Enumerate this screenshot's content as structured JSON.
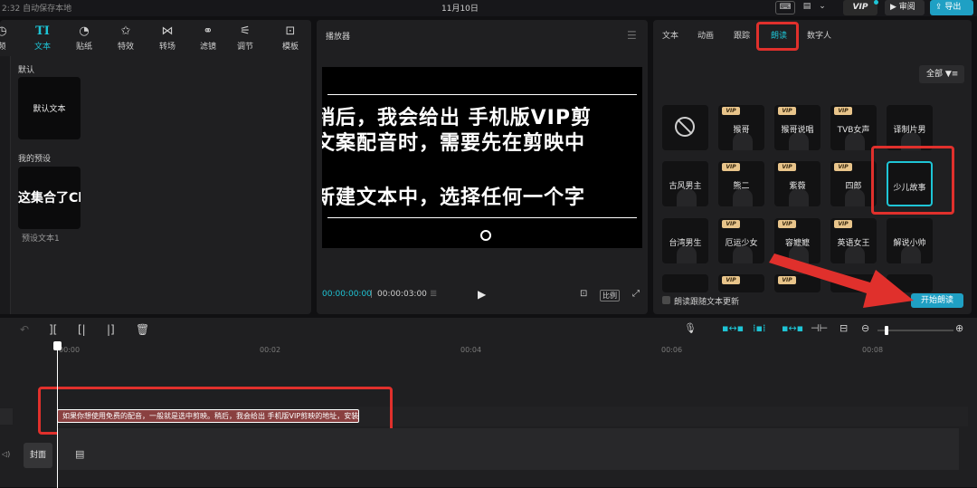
{
  "topbar": {
    "status": "2:32 自动保存本地",
    "date": "11月10日",
    "vip_label": "VIP",
    "review_label": "审阅",
    "export_label": "导出"
  },
  "left_panel": {
    "tabs": [
      {
        "icon": "◷",
        "label": "频",
        "icon_name": "media-icon"
      },
      {
        "icon": "TI",
        "label": "文本",
        "icon_name": "text-icon",
        "active": true
      },
      {
        "icon": "◔",
        "label": "贴纸",
        "icon_name": "sticker-icon"
      },
      {
        "icon": "✩",
        "label": "特效",
        "icon_name": "effects-icon"
      },
      {
        "icon": "⋈",
        "label": "转场",
        "icon_name": "transition-icon"
      },
      {
        "icon": "⚭",
        "label": "滤镜",
        "icon_name": "filter-icon"
      },
      {
        "icon": "⚟",
        "label": "调节",
        "icon_name": "adjust-icon"
      },
      {
        "icon": "⊡",
        "label": "模板",
        "icon_name": "template-icon"
      }
    ],
    "default_section": "默认",
    "default_text_card": "默认文本",
    "presets_section": "我的预设",
    "preset_card_text": "这集合了Ch",
    "preset_name": "预设文本1"
  },
  "player": {
    "title": "播放器",
    "lines": [
      "稍后，我会给出 手机版VIP剪",
      "文案配音时，需要先在剪映中",
      "新建文本中，选择任何一个字"
    ],
    "current_time": "00:00:00:00",
    "separator": "|",
    "total_time": "00:00:03:00",
    "ratio_label": "比例"
  },
  "right_panel": {
    "tabs": [
      "文本",
      "动画",
      "跟踪",
      "朗读",
      "数字人"
    ],
    "active_tab": "朗读",
    "filter_label": "全部",
    "voices": [
      {
        "name": "",
        "vip": false,
        "none": true
      },
      {
        "name": "猴哥",
        "vip": true
      },
      {
        "name": "猴哥说唱",
        "vip": true
      },
      {
        "name": "TVB女声",
        "vip": true
      },
      {
        "name": "译制片男",
        "vip": false
      },
      {
        "name": "古风男主",
        "vip": false
      },
      {
        "name": "熊二",
        "vip": true
      },
      {
        "name": "紫薇",
        "vip": true
      },
      {
        "name": "四郎",
        "vip": true
      },
      {
        "name": "少儿故事",
        "vip": false,
        "selected": true
      },
      {
        "name": "台湾男生",
        "vip": false
      },
      {
        "name": "厄运少女",
        "vip": true
      },
      {
        "name": "容嬷嬷",
        "vip": true
      },
      {
        "name": "英语女王",
        "vip": true
      },
      {
        "name": "解说小帅",
        "vip": false
      },
      {
        "name": "",
        "vip": false
      },
      {
        "name": "",
        "vip": true
      },
      {
        "name": "",
        "vip": true
      },
      {
        "name": "",
        "vip": false
      },
      {
        "name": "",
        "vip": false
      }
    ],
    "vip_badge": "VIP",
    "follow_label": "朗读跟随文本更新",
    "start_label": "开始朗读"
  },
  "timeline": {
    "ticks": [
      "00:00",
      "00:02",
      "00:04",
      "00:06",
      "00:08"
    ],
    "text_clip": "如果你想使用免费的配音，一般就是选中剪映。稍后，我会给出 手机版VIP剪映的地址，安装",
    "cover_label": "封面"
  },
  "colors": {
    "accent": "#1ec5d6",
    "highlight_red": "#e0302c",
    "primary_button": "#1fa0c4"
  }
}
